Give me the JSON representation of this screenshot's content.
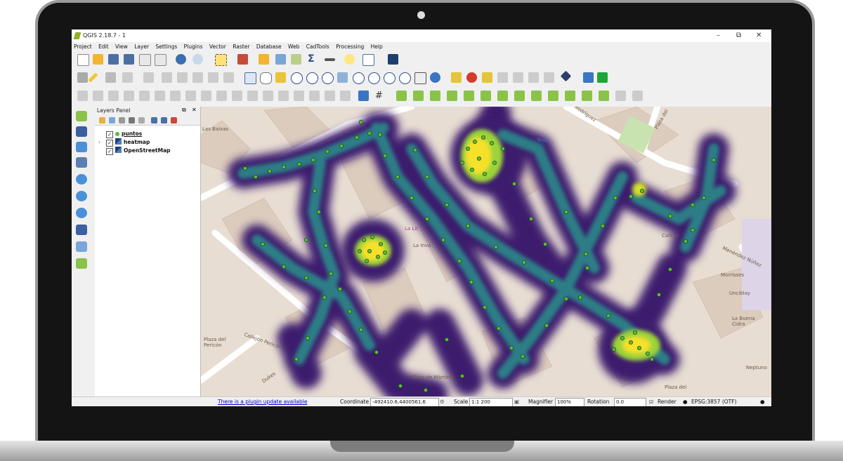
{
  "window": {
    "title": "QGIS 2.18.7 - 1",
    "minimize": "–",
    "restore": "⧉",
    "close": "✕"
  },
  "menu": [
    "Project",
    "Edit",
    "View",
    "Layer",
    "Settings",
    "Plugins",
    "Vector",
    "Raster",
    "Database",
    "Web",
    "CadTools",
    "Processing",
    "Help"
  ],
  "layers_panel": {
    "title": "Layers Panel",
    "layers": [
      {
        "name": "puntos",
        "checked": true,
        "symbol": "point-icon"
      },
      {
        "name": "heatmap",
        "checked": true,
        "symbol": "raster-icon"
      },
      {
        "name": "OpenStreetMap",
        "checked": true,
        "symbol": "raster-icon"
      }
    ]
  },
  "map": {
    "labels": [
      "Las Baixas",
      "Tejón",
      "Rodríguez",
      "Plaza del",
      "Plaza del Pericón",
      "Callejón Pericón",
      "La Lit",
      "La Inva",
      "Café el",
      "Morrisses",
      "Unciblay",
      "La Buena Cidra",
      "Neptuno",
      "Plaza de Mártires",
      "Plaza del",
      "Menéndez Núñez",
      "Dukes"
    ]
  },
  "status": {
    "plugin_update": "There is a plugin update available",
    "coordinate_label": "Coordinate",
    "coordinate_value": "-492410.6,4400561.6",
    "scale_label": "Scale",
    "scale_value": "1:1 200",
    "magnifier_label": "Magnifier",
    "magnifier_value": "100%",
    "rotation_label": "Rotation",
    "rotation_value": "0.0",
    "render_label": "Render",
    "crs": "EPSG:3857 (OTF)"
  },
  "colors": {
    "heat_low": "#3b1a6e",
    "heat_mid": "#2a9a8a",
    "heat_high": "#f5e02a",
    "point": "#5bbf3a"
  }
}
